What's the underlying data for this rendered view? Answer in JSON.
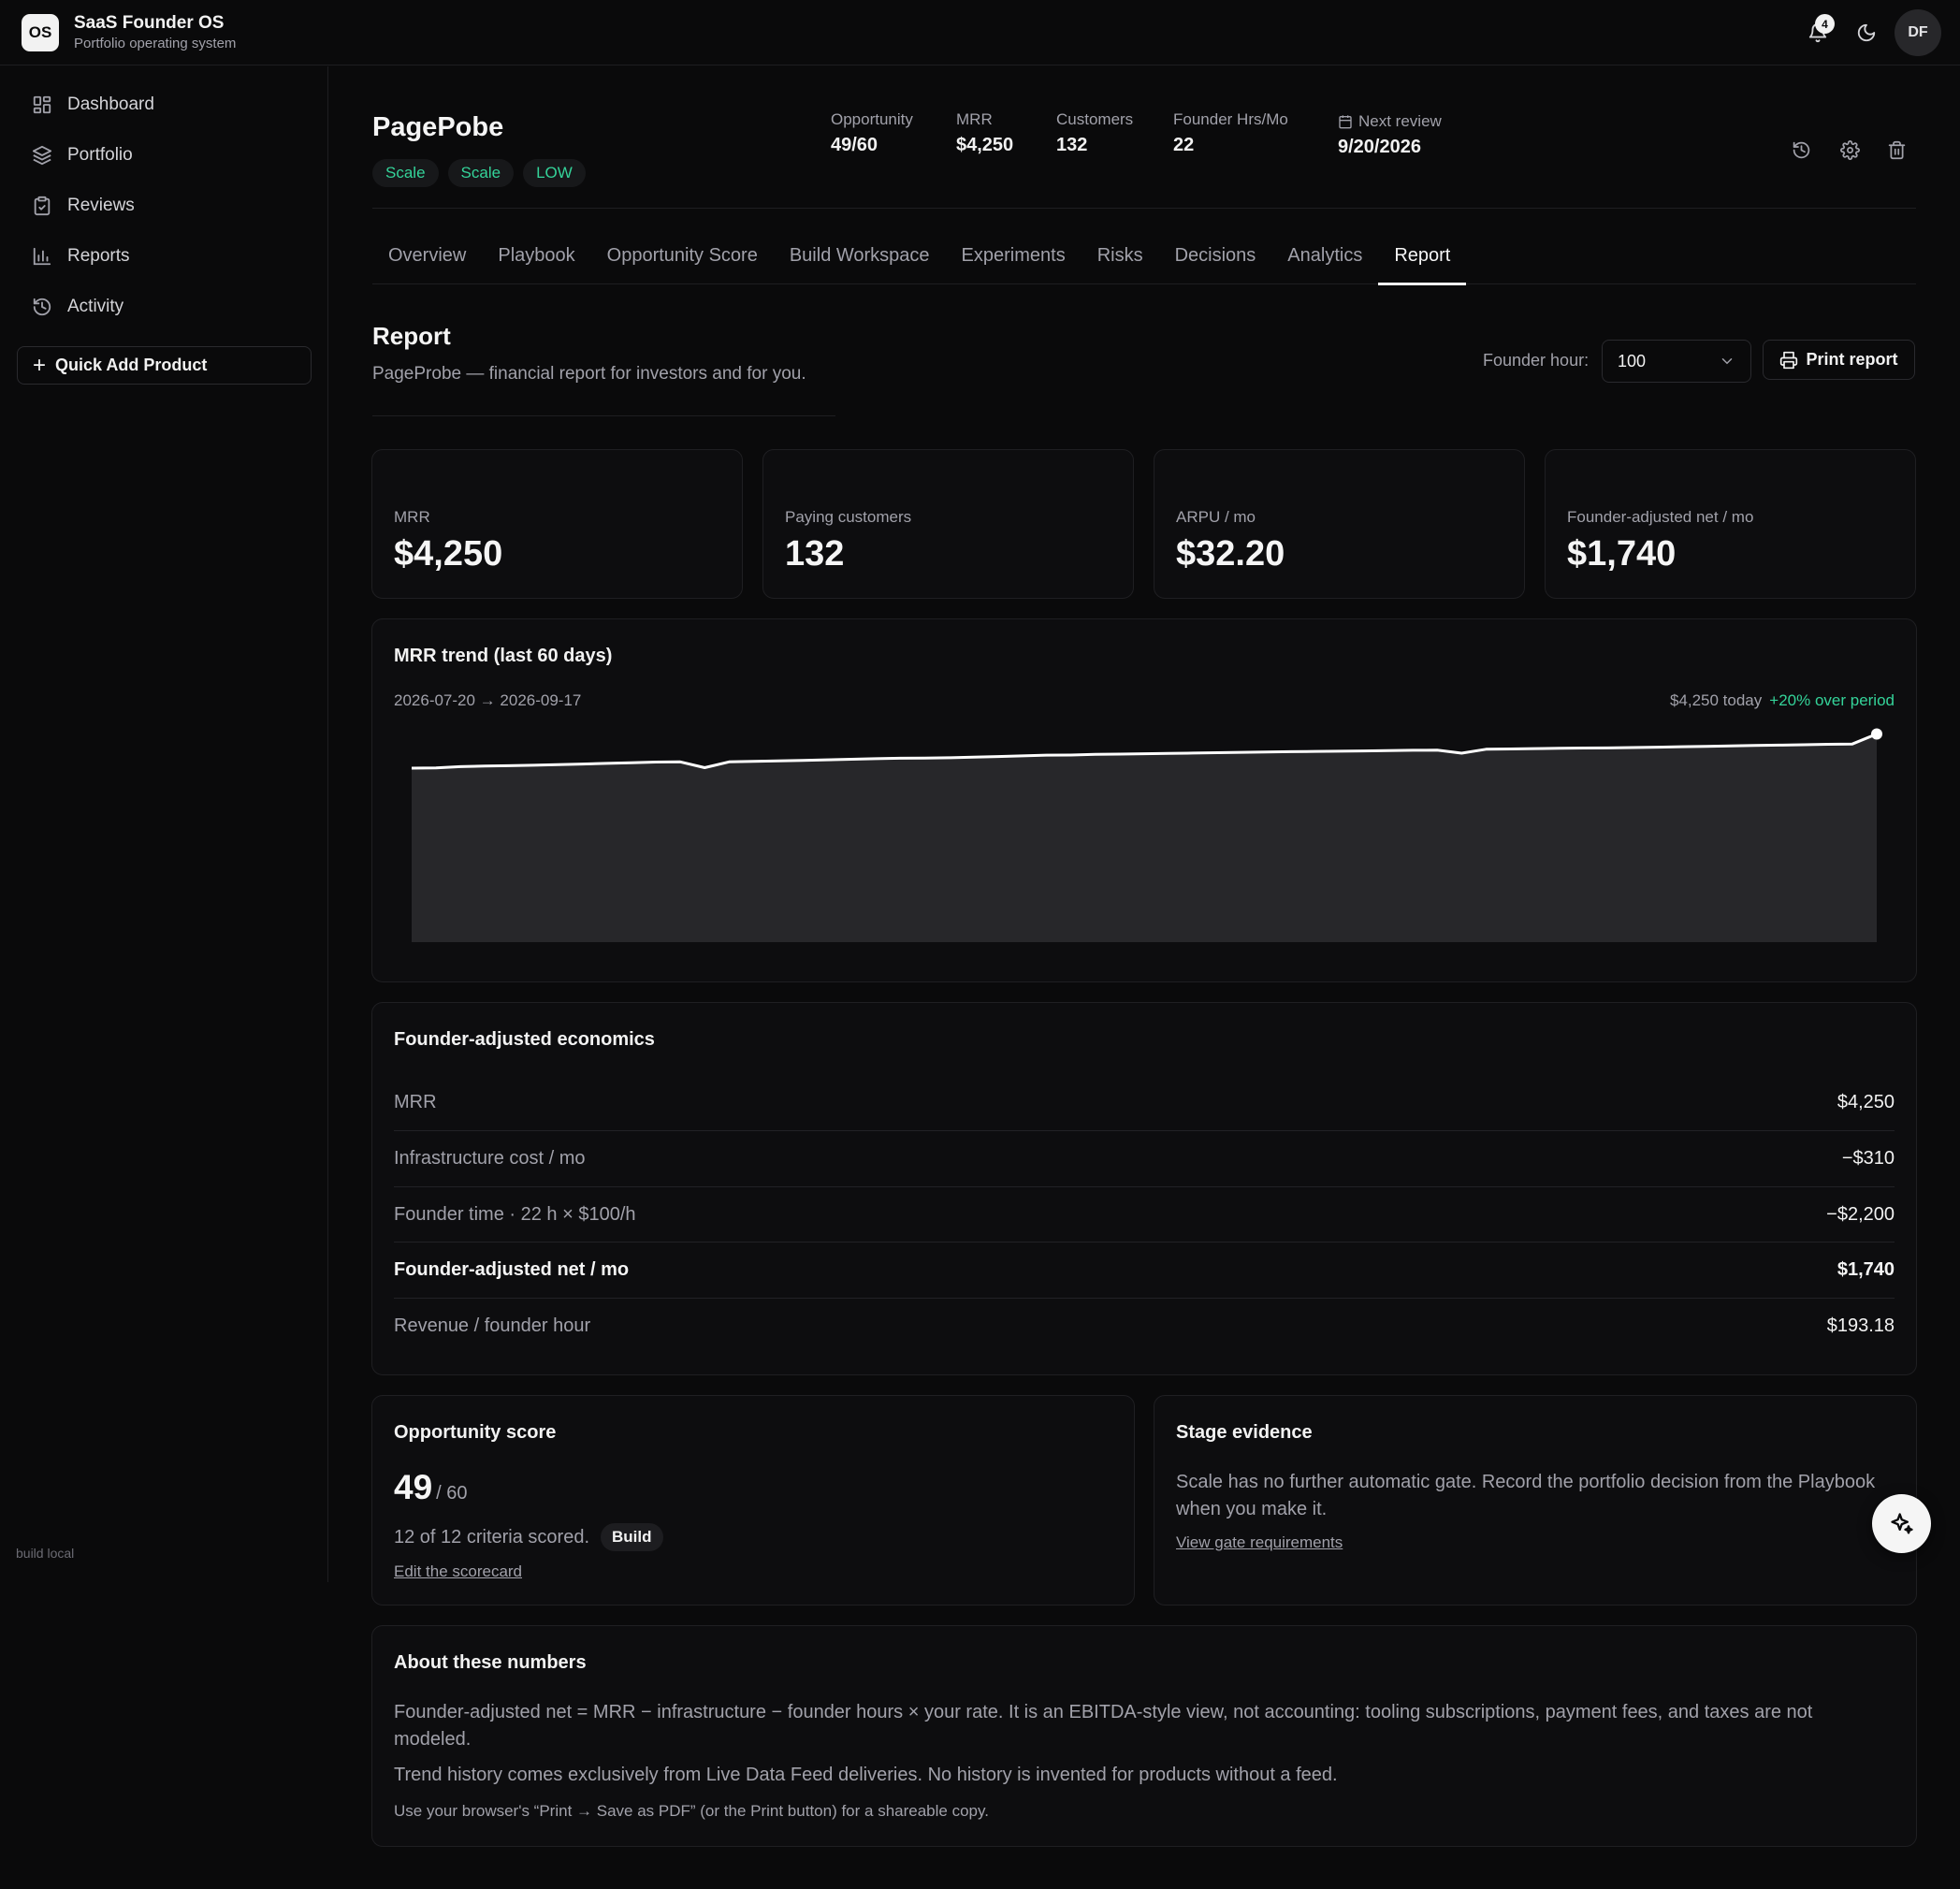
{
  "app": {
    "logo": "OS",
    "title": "SaaS Founder OS",
    "subtitle": "Portfolio operating system"
  },
  "topbar": {
    "notifications_count": "4",
    "avatar_initials": "DF",
    "icons": [
      "bell-icon",
      "moon-icon"
    ]
  },
  "sidebar": {
    "items": [
      {
        "label": "Dashboard",
        "icon": "dashboard-icon"
      },
      {
        "label": "Portfolio",
        "icon": "layers-icon"
      },
      {
        "label": "Reviews",
        "icon": "clipboard-check-icon"
      },
      {
        "label": "Reports",
        "icon": "bar-chart-icon"
      },
      {
        "label": "Activity",
        "icon": "history-icon"
      }
    ],
    "quick_add": "Quick Add Product",
    "build": "build local"
  },
  "product": {
    "name": "PagePobe",
    "chips": [
      "Scale",
      "Scale",
      "LOW"
    ],
    "stats": [
      {
        "label": "Opportunity",
        "value": "49/60"
      },
      {
        "label": "MRR",
        "value": "$4,250"
      },
      {
        "label": "Customers",
        "value": "132"
      },
      {
        "label": "Founder Hrs/Mo",
        "value": "22"
      }
    ],
    "next_review": {
      "label": "Next review",
      "value": "9/20/2026"
    }
  },
  "tabs": [
    "Overview",
    "Playbook",
    "Opportunity Score",
    "Build Workspace",
    "Experiments",
    "Risks",
    "Decisions",
    "Analytics",
    "Report"
  ],
  "active_tab": "Report",
  "report": {
    "title": "Report",
    "subtitle": "PageProbe — financial report for investors and for you.",
    "founder_hour_label": "Founder hour:",
    "founder_hour_value": "100",
    "print_label": "Print report"
  },
  "kpis": [
    {
      "label": "MRR",
      "value": "$4,250"
    },
    {
      "label": "Paying customers",
      "value": "132"
    },
    {
      "label": "ARPU / mo",
      "value": "$32.20"
    },
    {
      "label": "Founder-adjusted net / mo",
      "value": "$1,740"
    }
  ],
  "trend": {
    "title": "MRR trend (last 60 days)",
    "range": "2026-07-20 → 2026-09-17",
    "today": "$4,250 today",
    "delta": "+20% over period"
  },
  "chart_data": {
    "type": "area",
    "title": "MRR trend (last 60 days)",
    "x_start": "2026-07-20",
    "x_end": "2026-09-17",
    "values": [
      3540,
      3545,
      3570,
      3585,
      3590,
      3600,
      3612,
      3625,
      3638,
      3650,
      3665,
      3670,
      3550,
      3670,
      3680,
      3690,
      3700,
      3712,
      3725,
      3735,
      3745,
      3750,
      3755,
      3768,
      3780,
      3795,
      3810,
      3812,
      3825,
      3832,
      3838,
      3845,
      3852,
      3860,
      3868,
      3875,
      3882,
      3888,
      3892,
      3898,
      3905,
      3910,
      3912,
      3850,
      3932,
      3938,
      3945,
      3952,
      3958,
      3960,
      3968,
      3975,
      3985,
      3990,
      4000,
      4010,
      4018,
      4025,
      4035,
      4042,
      4250
    ],
    "final_value": 4250,
    "color": "#ffffff"
  },
  "economics": {
    "title": "Founder-adjusted economics",
    "rows": [
      {
        "label": "MRR",
        "value": "$4,250"
      },
      {
        "label": "Infrastructure cost / mo",
        "value": "−$310"
      },
      {
        "label": "Founder time · 22 h × $100/h",
        "value": "−$2,200"
      },
      {
        "label": "Founder-adjusted net / mo",
        "value": "$1,740"
      },
      {
        "label": "Revenue / founder hour",
        "value": "$193.18"
      }
    ]
  },
  "opportunity": {
    "title": "Opportunity score",
    "score": "49",
    "out_of": "/ 60",
    "criteria": "12 of 12 criteria scored.",
    "badge": "Build",
    "link": "Edit the scorecard"
  },
  "stage": {
    "title": "Stage evidence",
    "body": "Scale has no further automatic gate. Record the portfolio decision from the Playbook when you make it.",
    "link": "View gate requirements"
  },
  "about": {
    "title": "About these numbers",
    "p1": "Founder-adjusted net = MRR − infrastructure − founder hours × your rate. It is an EBITDA-style view, not accounting: tooling subscriptions, payment fees, and taxes are not modeled.",
    "p2": "Trend history comes exclusively from Live Data Feed deliveries. No history is invented for products without a feed.",
    "p3": "Use your browser's “Print → Save as PDF” (or the Print button) for a shareable copy."
  },
  "colors": {
    "background": "#0a0a0b",
    "accent_green": "#34d399",
    "text": "#ededed",
    "muted": "#a1a1aa"
  }
}
